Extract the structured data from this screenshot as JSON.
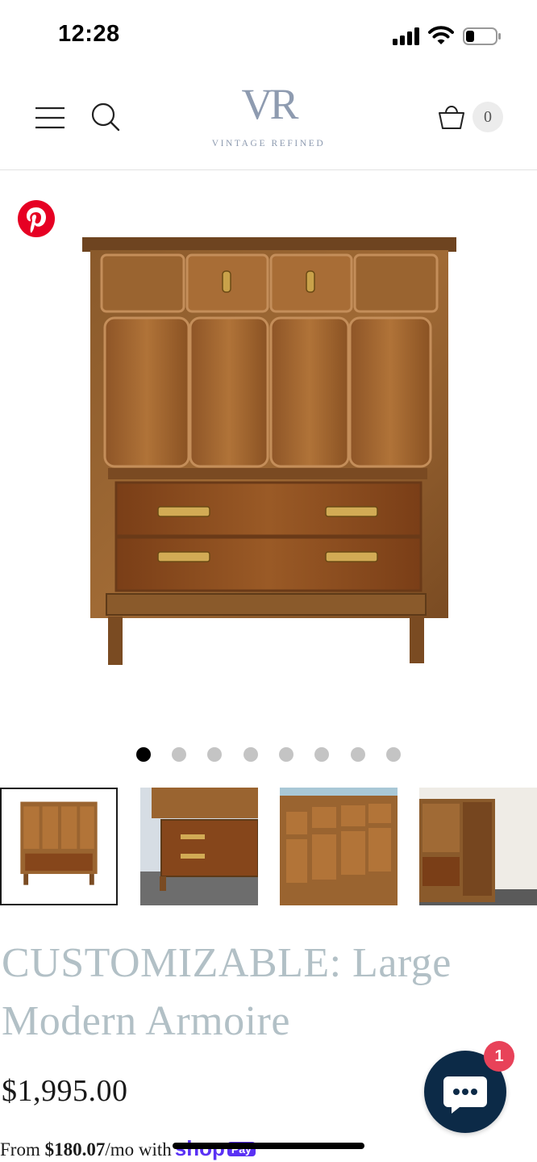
{
  "status_bar": {
    "time": "12:28",
    "icons": [
      "signal-icon",
      "wifi-icon",
      "battery-icon"
    ]
  },
  "header": {
    "logo_mark": "VR",
    "logo_text": "VINTAGE REFINED",
    "cart_count": "0",
    "icons": [
      "menu-icon",
      "search-icon",
      "cart-icon"
    ]
  },
  "gallery": {
    "image_count": 8,
    "active_index": 0,
    "thumbnail_count": 4,
    "pinterest_icon": "pinterest-icon"
  },
  "product": {
    "title": "CUSTOMIZABLE: Large Modern Armoire",
    "price": "$1,995.00",
    "installment_prefix": "From ",
    "installment_amount": "$180.07",
    "installment_suffix": "/mo with",
    "shop_word": "shop",
    "pay_badge": "Pay"
  },
  "chat": {
    "badge_count": "1",
    "icon": "chat-bubble-icon"
  },
  "colors": {
    "title": "#b2c0c6",
    "logo": "#8e9bb0",
    "chat_bg": "#0c2a47",
    "chat_badge": "#e84259",
    "pinterest": "#e60023",
    "shop_pay": "#5a31f4"
  }
}
